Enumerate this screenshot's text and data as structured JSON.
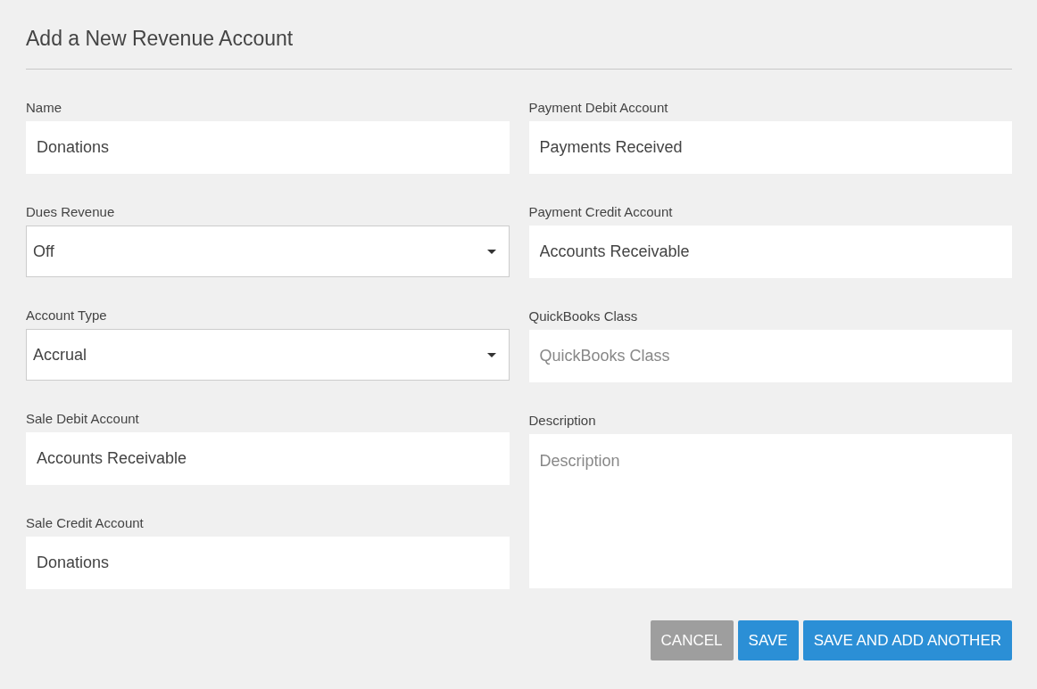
{
  "title": "Add a New Revenue Account",
  "left_fields": [
    {
      "kind": "text",
      "label": "Name",
      "value": "Donations"
    },
    {
      "kind": "select",
      "label": "Dues Revenue",
      "value": "Off"
    },
    {
      "kind": "select",
      "label": "Account Type",
      "value": "Accrual"
    },
    {
      "kind": "text",
      "label": "Sale Debit Account",
      "value": "Accounts Receivable"
    },
    {
      "kind": "text",
      "label": "Sale Credit Account",
      "value": "Donations"
    }
  ],
  "right_fields": [
    {
      "kind": "text",
      "label": "Payment Debit Account",
      "value": "Payments Received"
    },
    {
      "kind": "text",
      "label": "Payment Credit Account",
      "value": "Accounts Receivable"
    },
    {
      "kind": "text",
      "label": "QuickBooks Class",
      "placeholder": "QuickBooks Class"
    },
    {
      "kind": "textarea",
      "label": "Description",
      "placeholder": "Description"
    }
  ],
  "buttons": [
    {
      "kind": "secondary",
      "label": "CANCEL"
    },
    {
      "kind": "primary",
      "label": "SAVE"
    },
    {
      "kind": "primary",
      "label": "SAVE AND ADD ANOTHER"
    }
  ]
}
